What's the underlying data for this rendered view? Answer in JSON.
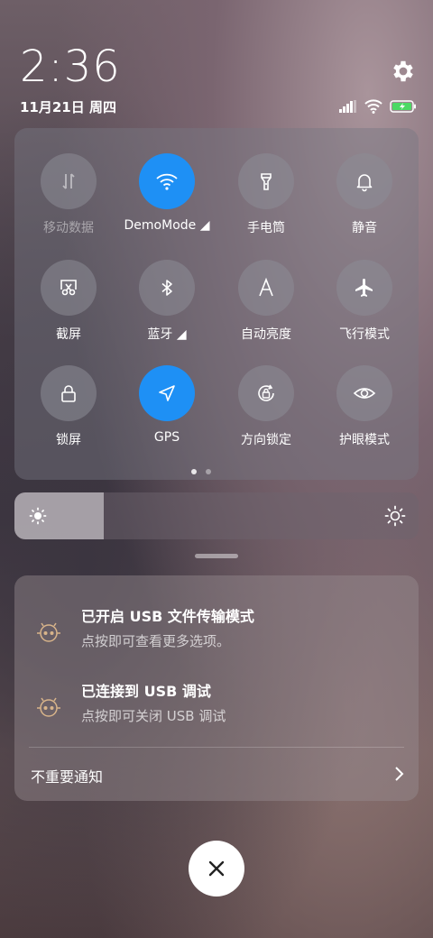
{
  "status": {
    "time": "2:36",
    "date": "11月21日 周四",
    "icons": [
      "signal-icon",
      "wifi-icon",
      "battery-charging-icon"
    ]
  },
  "settings_icon": "gear-icon",
  "quick_settings": {
    "tiles": [
      {
        "label": "移动数据",
        "icon": "mobile-data-icon",
        "active": false,
        "dimmed": true
      },
      {
        "label": "DemoMode ◢",
        "icon": "wifi-icon",
        "active": true,
        "dimmed": false
      },
      {
        "label": "手电筒",
        "icon": "flashlight-icon",
        "active": false,
        "dimmed": false
      },
      {
        "label": "静音",
        "icon": "bell-icon",
        "active": false,
        "dimmed": false
      },
      {
        "label": "截屏",
        "icon": "screenshot-icon",
        "active": false,
        "dimmed": false
      },
      {
        "label": "蓝牙 ◢",
        "icon": "bluetooth-icon",
        "active": false,
        "dimmed": false
      },
      {
        "label": "自动亮度",
        "icon": "auto-brightness-icon",
        "active": false,
        "dimmed": false
      },
      {
        "label": "飞行模式",
        "icon": "airplane-icon",
        "active": false,
        "dimmed": false
      },
      {
        "label": "锁屏",
        "icon": "lock-icon",
        "active": false,
        "dimmed": false
      },
      {
        "label": "GPS",
        "icon": "location-icon",
        "active": true,
        "dimmed": false
      },
      {
        "label": "方向锁定",
        "icon": "rotation-lock-icon",
        "active": false,
        "dimmed": false
      },
      {
        "label": "护眼模式",
        "icon": "eye-icon",
        "active": false,
        "dimmed": false
      }
    ],
    "page_count": 2,
    "current_page": 1,
    "active_color": "#1e90f5"
  },
  "brightness": {
    "level_percent": 22
  },
  "notifications": [
    {
      "title": "已开启 USB 文件传输模式",
      "subtitle": "点按即可查看更多选项。",
      "icon": "android-debug-icon"
    },
    {
      "title": "已连接到 USB 调试",
      "subtitle": "点按即可关闭 USB 调试",
      "icon": "android-debug-icon"
    }
  ],
  "unimportant_label": "不重要通知",
  "close_icon": "close-icon"
}
